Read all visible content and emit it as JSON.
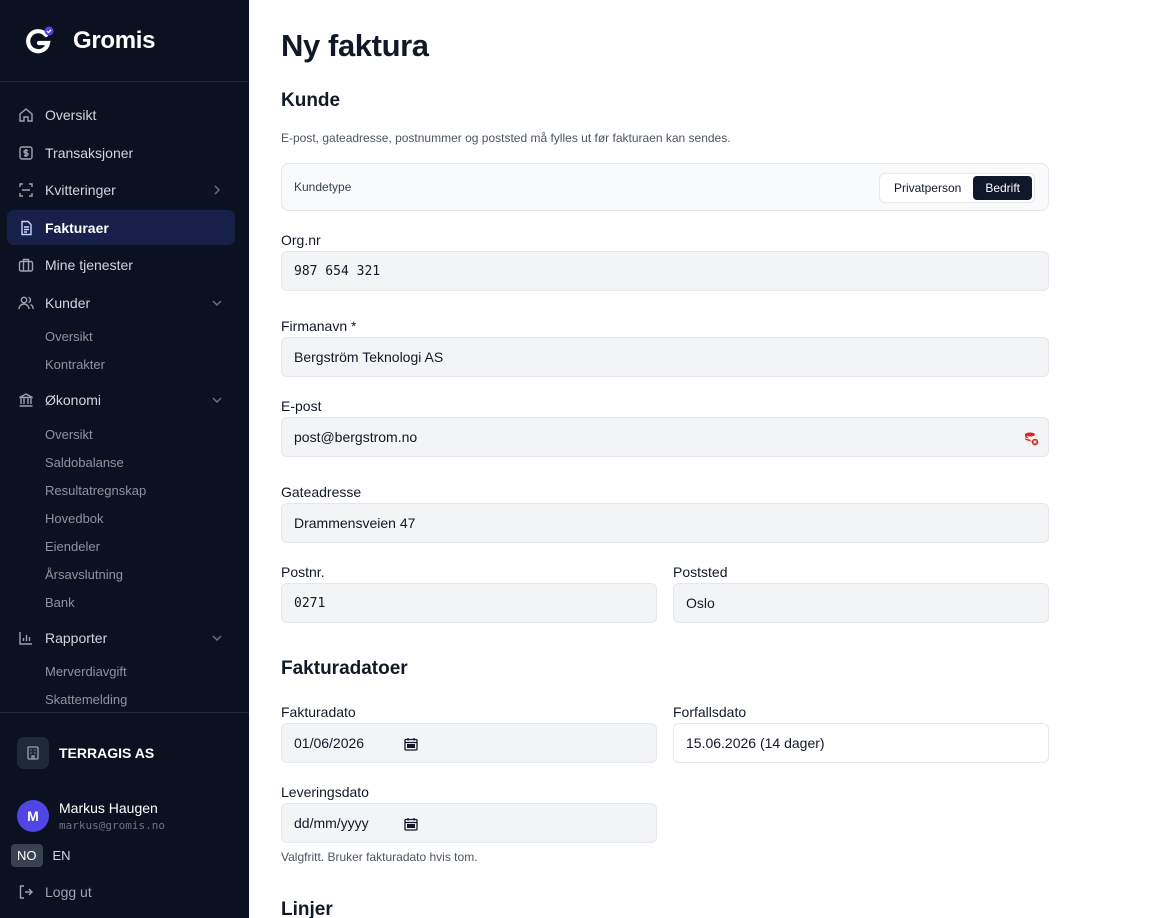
{
  "brand": {
    "name": "Gromis"
  },
  "nav": {
    "items": [
      {
        "label": "Oversikt"
      },
      {
        "label": "Transaksjoner"
      },
      {
        "label": "Kvitteringer"
      },
      {
        "label": "Fakturaer"
      },
      {
        "label": "Mine tjenester"
      },
      {
        "label": "Kunder"
      },
      {
        "label": "Økonomi"
      },
      {
        "label": "Rapporter"
      }
    ],
    "kunder_sub": [
      "Oversikt",
      "Kontrakter"
    ],
    "okonomi_sub": [
      "Oversikt",
      "Saldobalanse",
      "Resultatregnskap",
      "Hovedbok",
      "Eiendeler",
      "Årsavslutning",
      "Bank"
    ],
    "rapporter_sub": [
      "Merverdiavgift",
      "Skattemelding"
    ]
  },
  "org": {
    "name": "TERRAGIS AS"
  },
  "user": {
    "initial": "M",
    "name": "Markus Haugen",
    "email": "markus@gromis.no"
  },
  "lang": {
    "no": "NO",
    "en": "EN"
  },
  "logout": "Logg ut",
  "page": {
    "title": "Ny faktura",
    "kunde": {
      "title": "Kunde",
      "hint": "E-post, gateadresse, postnummer og poststed må fylles ut før fakturaen kan sendes.",
      "kundetype_label": "Kundetype",
      "toggle": {
        "privat": "Privatperson",
        "bedrift": "Bedrift"
      },
      "orgnr": {
        "label": "Org.nr",
        "value": "987 654 321"
      },
      "firmanavn": {
        "label": "Firmanavn *",
        "value": "Bergström Teknologi AS"
      },
      "epost": {
        "label": "E-post",
        "value": "post@bergstrom.no"
      },
      "gateadresse": {
        "label": "Gateadresse",
        "value": "Drammensveien 47"
      },
      "postnr": {
        "label": "Postnr.",
        "value": "0271"
      },
      "poststed": {
        "label": "Poststed",
        "value": "Oslo"
      }
    },
    "datoer": {
      "title": "Fakturadatoer",
      "fakturadato": {
        "label": "Fakturadato",
        "value": "01/06/2026"
      },
      "forfallsdato": {
        "label": "Forfallsdato",
        "value": "15.06.2026 (14 dager)"
      },
      "leveringsdato": {
        "label": "Leveringsdato",
        "placeholder": "dd/mm/yyyy"
      },
      "hint": "Valgfritt. Bruker fakturadato hvis tom."
    },
    "linjer": {
      "title": "Linjer"
    }
  }
}
